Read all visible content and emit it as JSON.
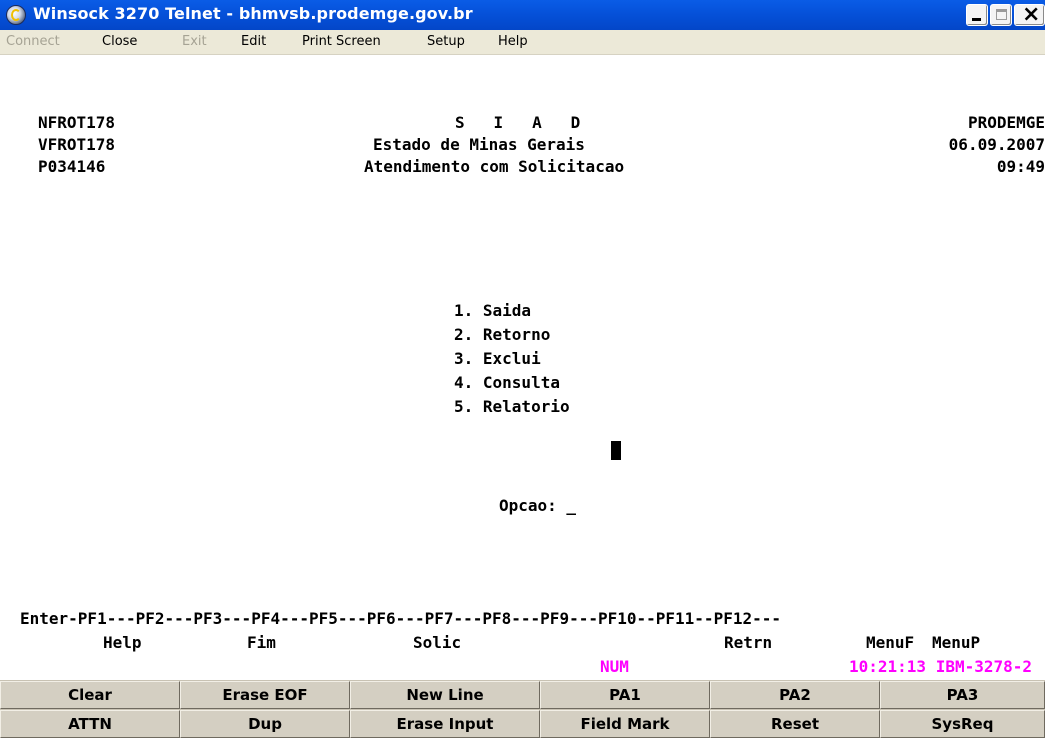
{
  "window": {
    "title": "Winsock 3270 Telnet - bhmvsb.prodemge.gov.br"
  },
  "menu": [
    "Connect",
    "Close",
    "Exit",
    "Edit",
    "Print Screen",
    "Setup",
    "Help"
  ],
  "screen": {
    "left": [
      "NFROT178",
      "VFROT178",
      "P034146"
    ],
    "center": [
      "S   I   A   D",
      "Estado de Minas Gerais",
      "Atendimento com Solicitacao"
    ],
    "right": [
      "PRODEMGE",
      "06.09.2007",
      "09:49"
    ],
    "options": [
      "1. Saida",
      "2. Retorno",
      "3. Exclui",
      "4. Consulta",
      "5. Relatorio"
    ],
    "prompt": "Opcao: _",
    "pf_line": "Enter-PF1---PF2---PF3---PF4---PF5---PF6---PF7---PF8---PF9---PF10--PF11--PF12---",
    "pf_labels": [
      "Help",
      "Fim",
      "Solic",
      "Retrn",
      "MenuF",
      "MenuP"
    ]
  },
  "status": {
    "num": "NUM",
    "info": "10:21:13 IBM-3278-2"
  },
  "keys": {
    "row1": [
      "Clear",
      "Erase EOF",
      "New Line",
      "PA1",
      "PA2",
      "PA3"
    ],
    "row2": [
      "ATTN",
      "Dup",
      "Erase Input",
      "Field Mark",
      "Reset",
      "SysReq"
    ]
  }
}
